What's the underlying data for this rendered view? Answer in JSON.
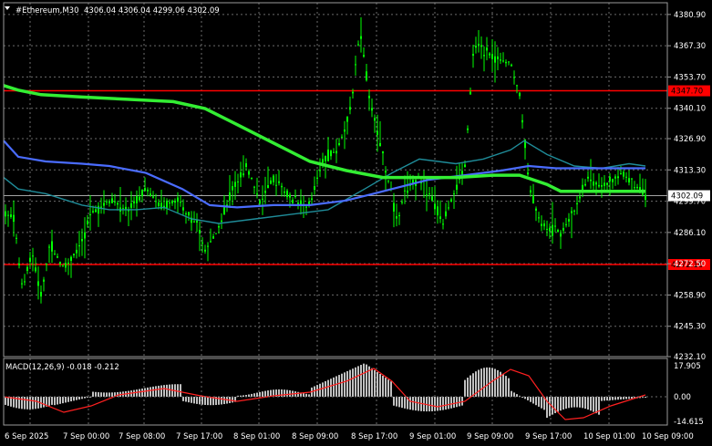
{
  "header": {
    "dropdown_icon": "triangle-down-icon",
    "symbol": "#Ethereum,M30",
    "ohlc": "4306.04 4306.04 4299.06 4302.09"
  },
  "colors": {
    "background": "#000000",
    "grid": "#6b6b6b",
    "candle": "#00ff00",
    "ma_slow": "#33ee33",
    "ma_mid": "#4a6cff",
    "ma_fast": "#1f8c99",
    "hline": "#ff0000",
    "current_price_bg": "#ffffff",
    "histogram": "#c0c0c0",
    "signal": "#ff2020"
  },
  "chart_data": [
    {
      "type": "line",
      "title": "#Ethereum,M30",
      "x": [
        "6 Sep 2025",
        "7 Sep 00:00",
        "7 Sep 08:00",
        "7 Sep 17:00",
        "8 Sep 01:00",
        "8 Sep 09:00",
        "8 Sep 17:00",
        "9 Sep 01:00",
        "9 Sep 09:00",
        "9 Sep 17:00",
        "10 Sep 01:00",
        "10 Sep 09:00"
      ],
      "ylim": [
        4232.1,
        4386.0
      ],
      "y_ticks": [
        "4380.90",
        "4367.30",
        "4353.70",
        "4340.10",
        "4326.90",
        "4313.30",
        "4299.70",
        "4286.10",
        "4272.50",
        "4258.90",
        "4245.30",
        "4232.10"
      ],
      "current_price": "4302.09",
      "horizontal_lines": [
        "4347.70",
        "4272.16"
      ],
      "grid": true
    },
    {
      "type": "bar",
      "title": "MACD(12,26,9) -0.018 -0.212",
      "y_ticks": [
        "17.905",
        "0.00",
        "-14.615"
      ],
      "ylim": [
        -14.615,
        17.905
      ]
    }
  ]
}
